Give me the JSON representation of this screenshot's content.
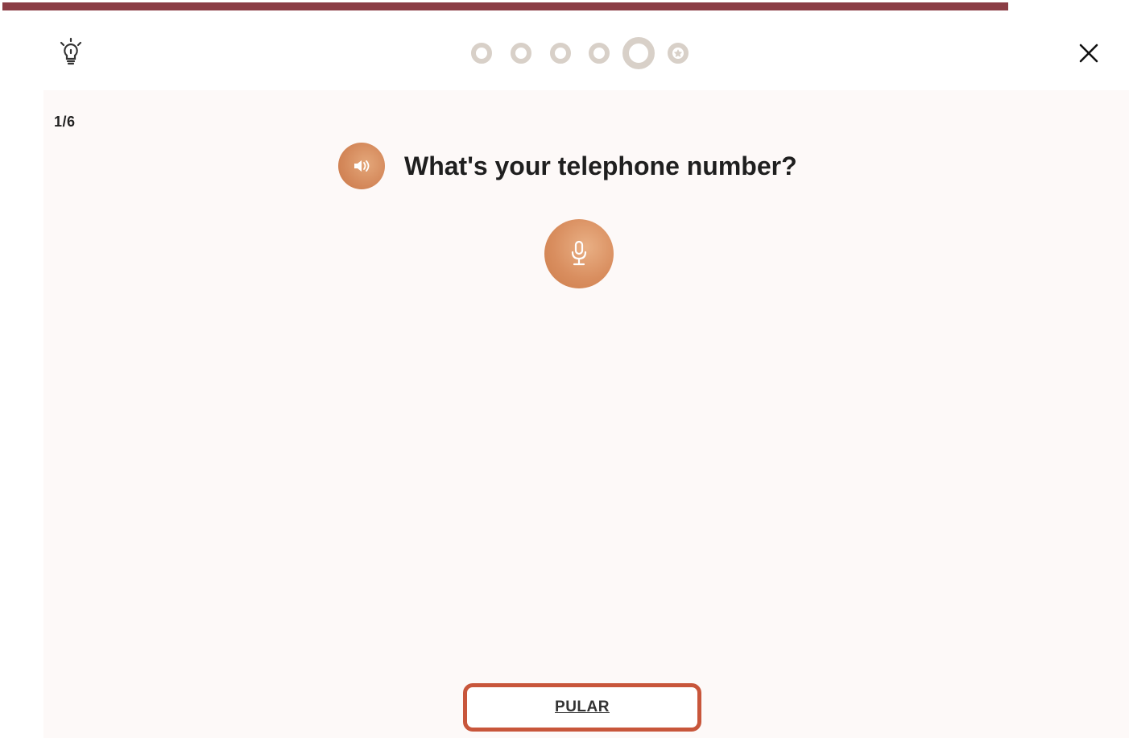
{
  "header": {
    "hint_icon": "lightbulb-icon",
    "close_icon": "close-icon",
    "progress": {
      "total": 6,
      "current": 5,
      "last_step_icon": "star-icon"
    }
  },
  "exercise": {
    "counter": "1/6",
    "question": "What's your telephone number?",
    "speaker_icon": "speaker-icon",
    "mic_icon": "microphone-icon",
    "skip_label": "PULAR"
  },
  "colors": {
    "top_bar": "#8b3d45",
    "accent": "#d98e5f",
    "highlight_border": "#c8563b",
    "progress_dot": "#d8d0c8"
  }
}
